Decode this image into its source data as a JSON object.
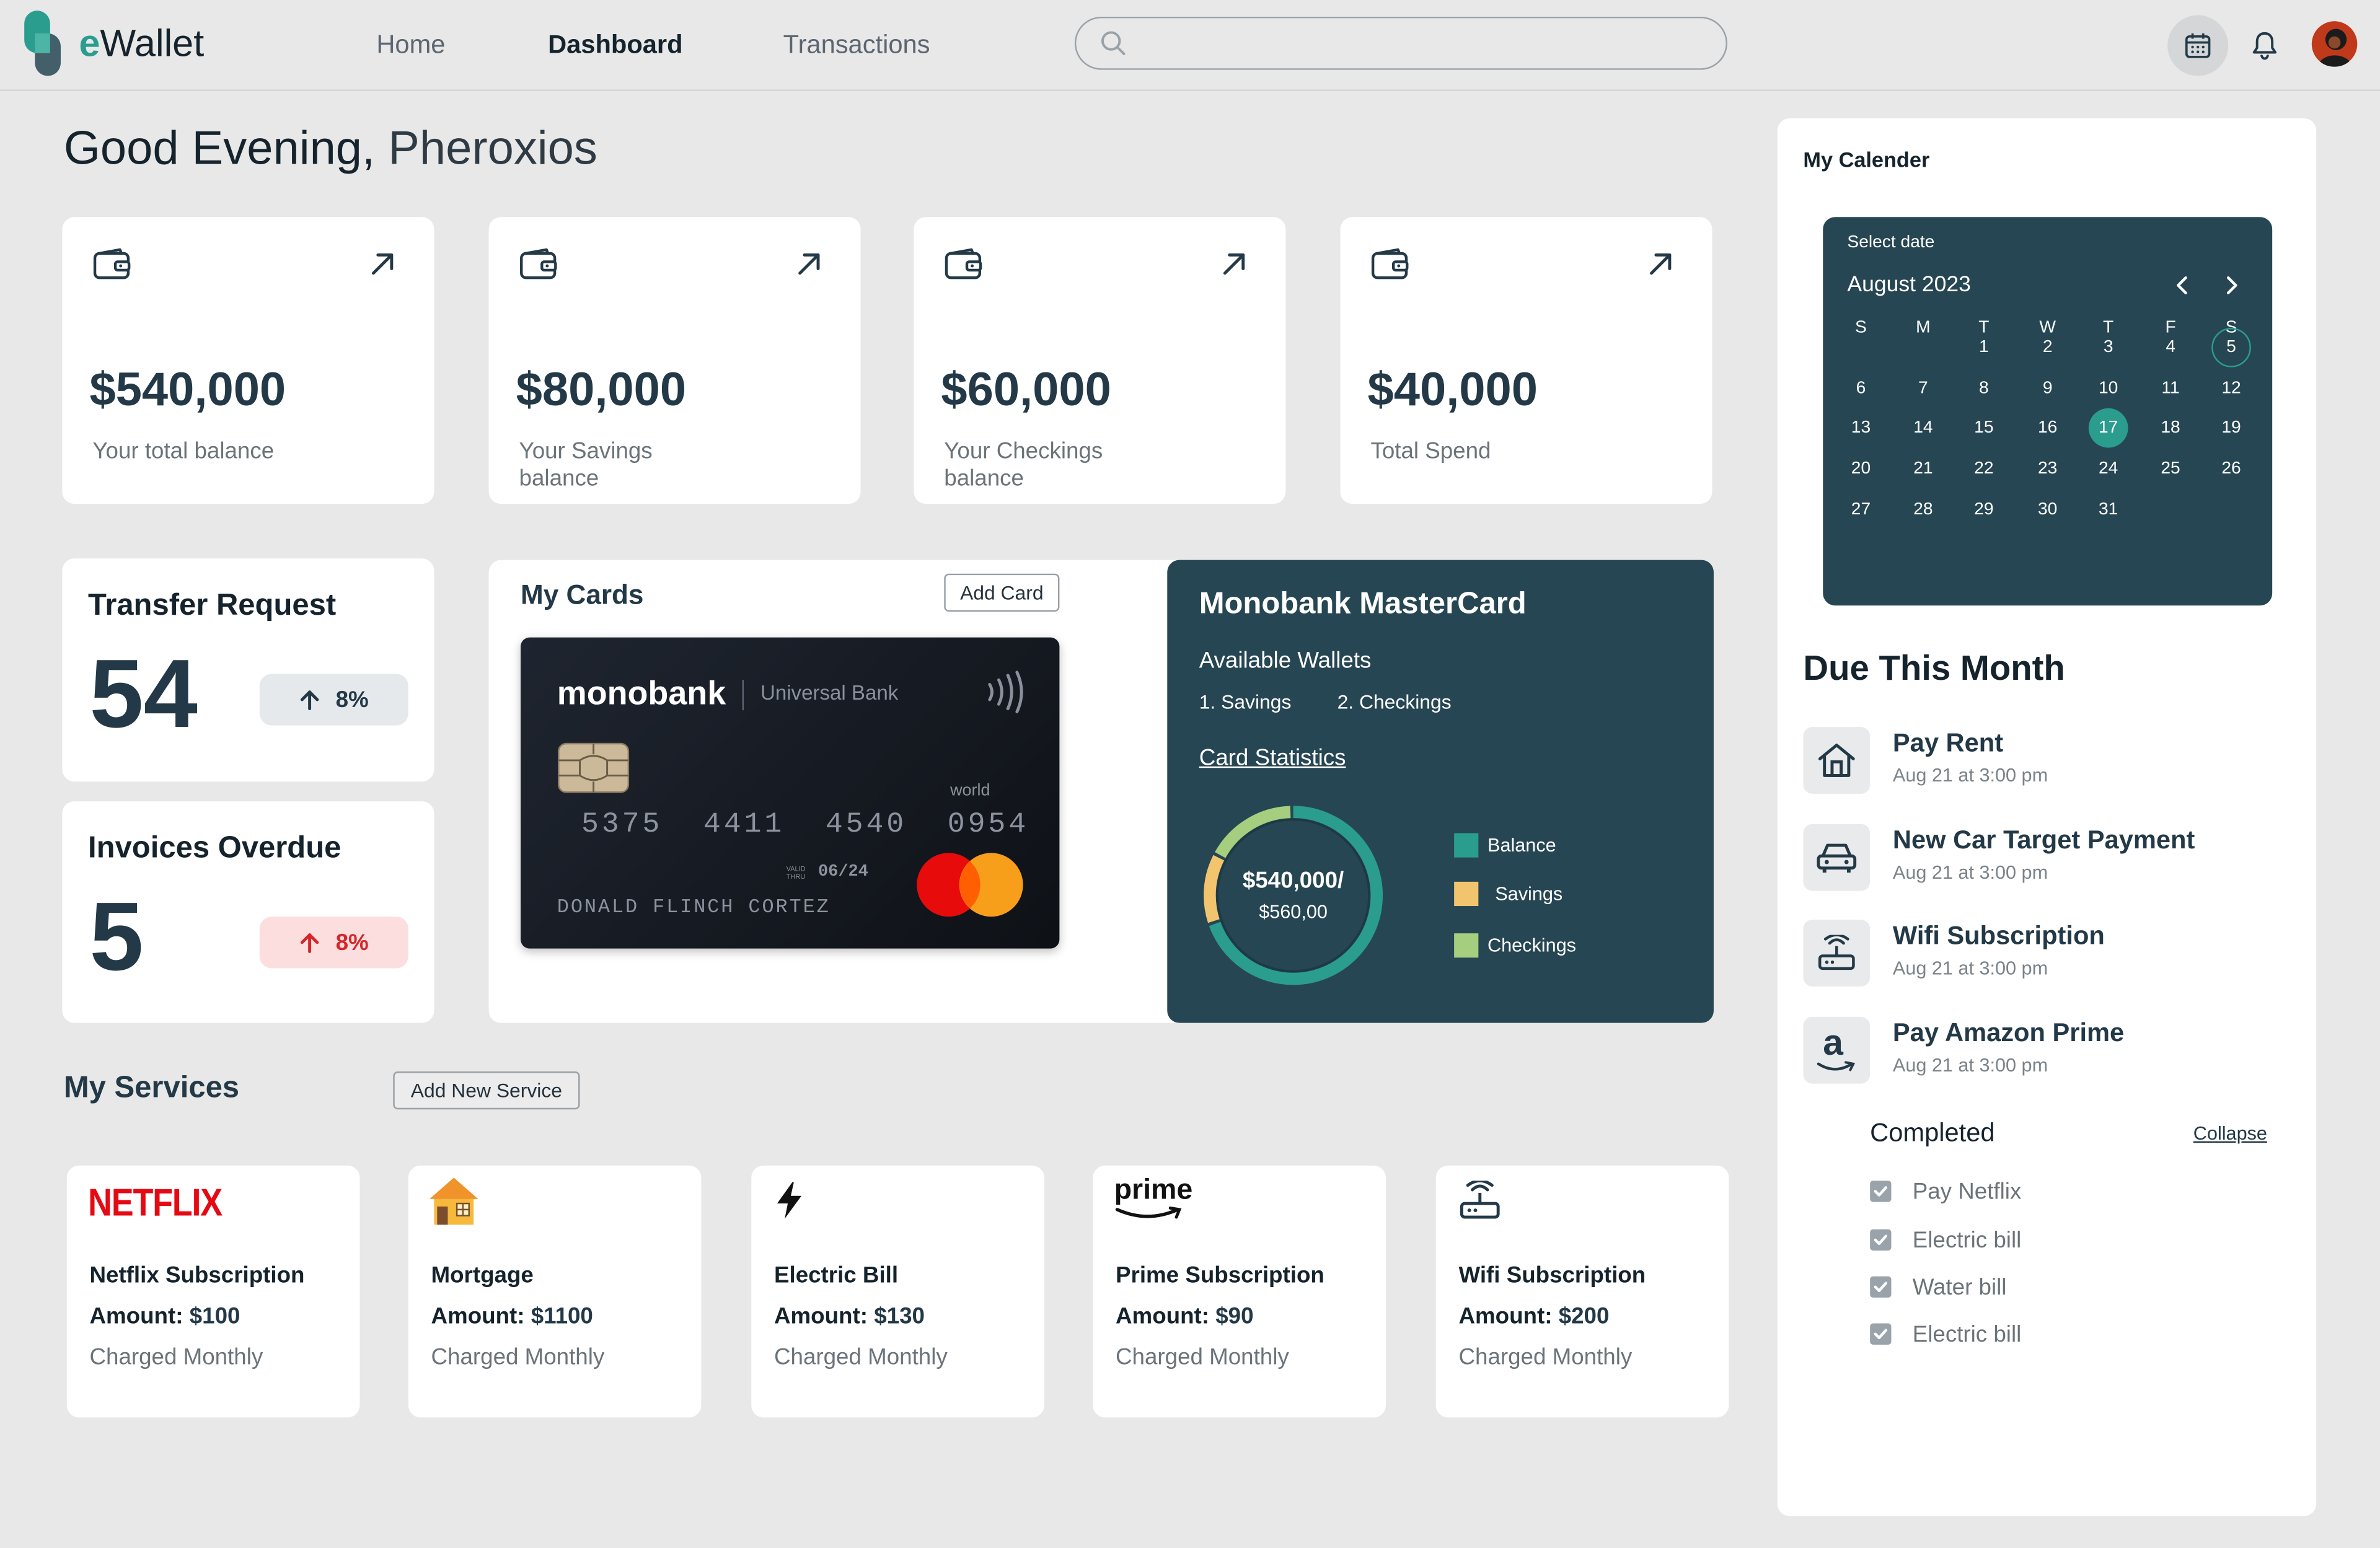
{
  "app": {
    "brand_prefix": "e",
    "brand_rest": "Wallet"
  },
  "nav": {
    "home": "Home",
    "dashboard": "Dashboard",
    "transactions": "Transactions"
  },
  "search": {
    "placeholder": ""
  },
  "greeting": {
    "salutation": "Good Evening,",
    "name": "Pheroxios"
  },
  "stats": [
    {
      "amount": "$540,000",
      "label": "Your total balance"
    },
    {
      "amount": "$80,000",
      "label": "Your Savings balance"
    },
    {
      "amount": "$60,000",
      "label": "Your Checkings balance"
    },
    {
      "amount": "$40,000",
      "label": "Total Spend"
    }
  ],
  "transfer": {
    "title": "Transfer Request",
    "count": "54",
    "change": "8%",
    "direction": "up"
  },
  "invoices": {
    "title": "Invoices Overdue",
    "count": "5",
    "change": "8%",
    "direction": "up"
  },
  "my_cards": {
    "title": "My Cards",
    "add_label": "Add Card",
    "card": {
      "brand": "monobank",
      "bank": "Universal Bank",
      "tier": "world",
      "number": "5375  4411  4540  0954",
      "valid_label": "VALID THRU",
      "expiry": "06/24",
      "holder": "DONALD FLINCH CORTEZ"
    }
  },
  "mastercard_panel": {
    "title": "Monobank MasterCard",
    "wallets_label": "Available Wallets",
    "wallets": [
      "1. Savings",
      "2. Checkings"
    ],
    "stats_link": "Card Statistics",
    "donut_amount": "$540,000/",
    "donut_sub": "$560,00",
    "legend": [
      {
        "label": "Balance",
        "color": "#2a9d8f"
      },
      {
        "label": "Savings",
        "color": "#f2c46d"
      },
      {
        "label": "Checkings",
        "color": "#a5cf7f"
      }
    ]
  },
  "chart_data": {
    "type": "pie",
    "labels": [
      "Balance",
      "Savings",
      "Checkings"
    ],
    "values": [
      0.7,
      0.13,
      0.17
    ],
    "colors": [
      "#2a9d8f",
      "#f2c46d",
      "#a5cf7f"
    ]
  },
  "services": {
    "title": "My Services",
    "add_label": "Add New Service",
    "amount_label": "Amount:",
    "items": [
      {
        "name": "Netflix Subscription",
        "amount": "$100",
        "frequency": "Charged Monthly",
        "icon": "netflix-logo",
        "logo_text": "NETFLIX"
      },
      {
        "name": "Mortgage",
        "amount": "$1100",
        "frequency": "Charged Monthly",
        "icon": "house-icon"
      },
      {
        "name": "Electric Bill",
        "amount": "$130",
        "frequency": "Charged Monthly",
        "icon": "lightning-icon"
      },
      {
        "name": "Prime Subscription",
        "amount": "$90",
        "frequency": "Charged Monthly",
        "icon": "prime-logo",
        "logo_text": "prime"
      },
      {
        "name": "Wifi Subscription",
        "amount": "$200",
        "frequency": "Charged Monthly",
        "icon": "router-icon"
      }
    ]
  },
  "calendar": {
    "title": "My Calender",
    "select_label": "Select date",
    "month": "August 2023",
    "weekdays": [
      "S",
      "M",
      "T",
      "W",
      "T",
      "F",
      "S"
    ],
    "weeks": [
      [
        "",
        "",
        "1",
        "2",
        "3",
        "4",
        "5"
      ],
      [
        "6",
        "7",
        "8",
        "9",
        "10",
        "11",
        "12"
      ],
      [
        "13",
        "14",
        "15",
        "16",
        "17",
        "18",
        "19"
      ],
      [
        "20",
        "21",
        "22",
        "23",
        "24",
        "25",
        "26"
      ],
      [
        "27",
        "28",
        "29",
        "30",
        "31",
        "",
        ""
      ]
    ],
    "selected": "17",
    "ring": "5",
    "accent": "#2a9d8f",
    "panel_color": "#264653"
  },
  "due": {
    "title": "Due This Month",
    "items": [
      {
        "title": "Pay Rent",
        "when": "Aug 21 at 3:00 pm",
        "icon": "house-icon"
      },
      {
        "title": "New Car Target Payment",
        "when": "Aug 21 at 3:00 pm",
        "icon": "car-icon"
      },
      {
        "title": "Wifi Subscription",
        "when": "Aug 21 at 3:00 pm",
        "icon": "router-icon"
      },
      {
        "title": "Pay Amazon Prime",
        "when": "Aug 21 at 3:00 pm",
        "icon": "amazon-icon",
        "logo_text": "a"
      }
    ],
    "completed_title": "Completed",
    "collapse_label": "Collapse",
    "completed": [
      "Pay Netflix",
      "Electric bill",
      "Water bill",
      "Electric bill"
    ]
  }
}
